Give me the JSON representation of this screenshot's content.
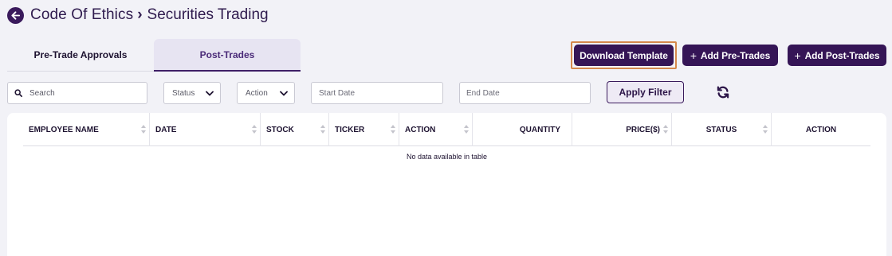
{
  "breadcrumb": {
    "parent": "Code Of Ethics",
    "separator": "›",
    "current": "Securities Trading"
  },
  "tabs": [
    {
      "label": "Pre-Trade Approvals",
      "active": false
    },
    {
      "label": "Post-Trades",
      "active": true
    }
  ],
  "toolbar": {
    "download_label": "Download Template",
    "add_pre_label": "Add Pre-Trades",
    "add_post_label": "Add Post-Trades",
    "plus": "+"
  },
  "filters": {
    "search_placeholder": "Search",
    "status_label": "Status",
    "action_label": "Action",
    "start_date_placeholder": "Start Date",
    "end_date_placeholder": "End Date",
    "apply_label": "Apply Filter"
  },
  "table": {
    "columns": [
      "EMPLOYEE NAME",
      "DATE",
      "STOCK",
      "TICKER",
      "ACTION",
      "QUANTITY",
      "PRICE($)",
      "STATUS",
      "ACTION"
    ],
    "empty_message": "No data available in table"
  },
  "colors": {
    "brand": "#351556",
    "highlight": "#d4884c",
    "background": "#f2f2f7"
  },
  "icons": {
    "back": "arrow-left-circle-icon",
    "search": "search-icon",
    "refresh": "refresh-icon",
    "chevron": "chevron-down-icon"
  }
}
